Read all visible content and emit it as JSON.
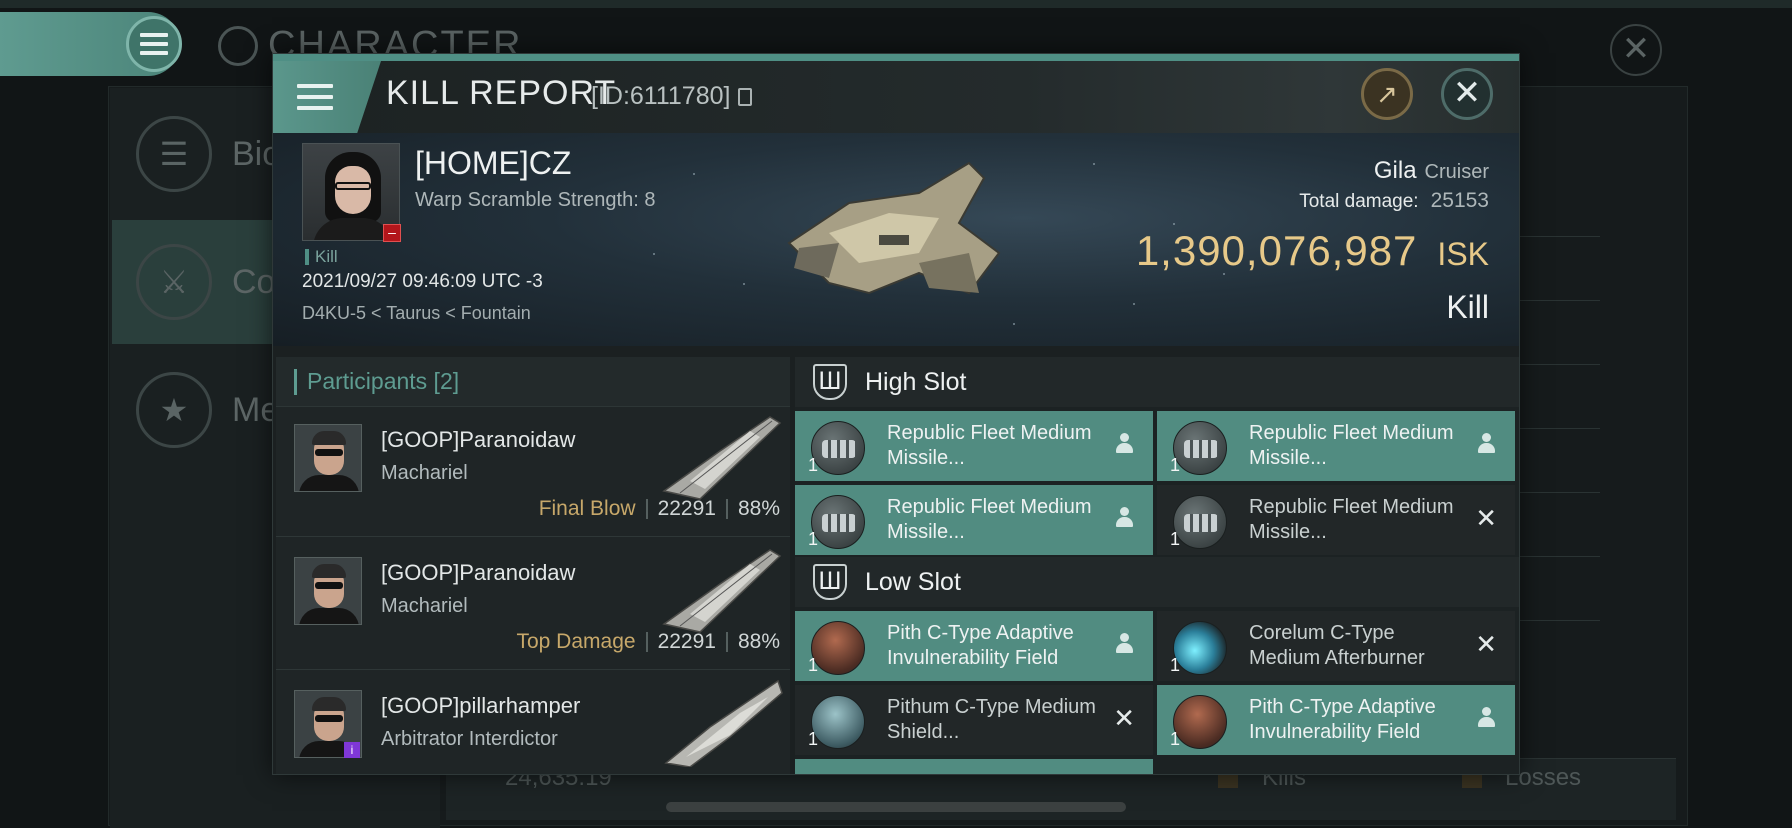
{
  "background": {
    "title": "CHARACTER",
    "side_items": [
      {
        "label": "Bio"
      },
      {
        "label": "Co"
      },
      {
        "label": "Me"
      }
    ],
    "bottom_value": "24,635.19",
    "bottom_kills": "Kills",
    "bottom_losses": "Losses"
  },
  "kill_report": {
    "title": "KILL REPORT",
    "id_label": "[ID:6111780]",
    "victim": {
      "name": "[HOME]CZ",
      "warp_scramble": "Warp Scramble Strength: 8",
      "tag": "Kill",
      "datetime": "2021/09/27 09:46:09 UTC -3",
      "location": "D4KU-5 < Taurus < Fountain"
    },
    "ship": {
      "name": "Gila",
      "class": "Cruiser",
      "damage_label": "Total damage:",
      "damage_value": "25153",
      "isk_value": "1,390,076,987",
      "isk_unit": "ISK",
      "kind": "Kill"
    },
    "participants": {
      "header": "Participants [2]",
      "rows": [
        {
          "name": "[GOOP]Paranoidaw",
          "ship": "Machariel",
          "label": "Final Blow",
          "damage": "22291",
          "percent": "88%"
        },
        {
          "name": "[GOOP]Paranoidaw",
          "ship": "Machariel",
          "label": "Top Damage",
          "damage": "22291",
          "percent": "88%"
        },
        {
          "name": "[GOOP]pillarhamper",
          "ship": "Arbitrator Interdictor",
          "label": "",
          "damage": "",
          "percent": ""
        }
      ]
    },
    "high_slot": {
      "label": "High Slot",
      "modules": [
        {
          "name": "Republic Fleet Medium Missile...",
          "qty": "1",
          "status": "fitted"
        },
        {
          "name": "Republic Fleet Medium Missile...",
          "qty": "1",
          "status": "fitted"
        },
        {
          "name": "Republic Fleet Medium Missile...",
          "qty": "1",
          "status": "fitted"
        },
        {
          "name": "Republic Fleet Medium Missile...",
          "qty": "1",
          "status": "destroyed"
        }
      ]
    },
    "low_slot": {
      "label": "Low Slot",
      "modules": [
        {
          "name": "Pith C-Type Adaptive Invulnerability Field",
          "qty": "1",
          "status": "fitted"
        },
        {
          "name": "Corelum C-Type Medium Afterburner",
          "qty": "1",
          "status": "destroyed"
        },
        {
          "name": "Pithum C-Type Medium Shield...",
          "qty": "1",
          "status": "destroyed"
        },
        {
          "name": "Pith C-Type Adaptive Invulnerability Field",
          "qty": "1",
          "status": "fitted"
        }
      ]
    }
  },
  "colors": {
    "accent": "#518c81",
    "isk_gold": "#e7c989",
    "label_gold": "#c7a86a",
    "destroyed_bg": "#222728"
  }
}
